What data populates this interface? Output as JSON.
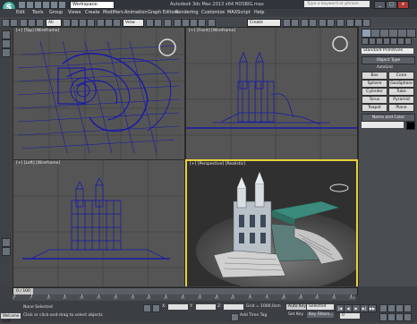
{
  "title_bar": {
    "logo_glyph": "S",
    "workspace": "Workspace: Default",
    "app_title": "Autodesk 3ds Max 2013 x64    HOSBIG.max",
    "search_placeholder": "Type a keyword or phrase"
  },
  "menu": [
    "Edit",
    "Tools",
    "Group",
    "Views",
    "Create",
    "Modifiers",
    "Animation",
    "Graph Editors",
    "Rendering",
    "Customize",
    "MAXScript",
    "Help"
  ],
  "toolbar": {
    "filter": "All",
    "ref_coord": "View",
    "selection_set": "Create Selection Se"
  },
  "viewports": [
    {
      "label": "[+] [Top] [Wireframe]"
    },
    {
      "label": "[+] [Front] [Wireframe]"
    },
    {
      "label": "[+] [Left] [Wireframe]"
    },
    {
      "label": "[+] [Perspective] [Realistic]"
    }
  ],
  "command_panel": {
    "category": "Standard Primitives",
    "object_type_title": "Object Type",
    "autogrid": "AutoGrid",
    "buttons": [
      "Box",
      "Cone",
      "Sphere",
      "GeoSphere",
      "Cylinder",
      "Tube",
      "Torus",
      "Pyramid",
      "Teapot",
      "Plane"
    ],
    "name_and_color": "Name and Color"
  },
  "timeline": {
    "frame_counter": "0 / 100",
    "ticks": [
      "0",
      "5",
      "10",
      "15",
      "20",
      "25",
      "30",
      "35",
      "40",
      "45",
      "50",
      "55",
      "60",
      "65",
      "70",
      "75",
      "80",
      "85",
      "90",
      "95",
      "100"
    ]
  },
  "status": {
    "welcome": "Welcome to M",
    "selection": "None Selected",
    "prompt": "Click or click-and-drag to select objects",
    "x_label": "X:",
    "y_label": "Y:",
    "z_label": "Z:",
    "grid": "Grid = 1000,0cm",
    "auto_key": "Auto Key",
    "selected": "Selected",
    "set_key": "Set Key",
    "key_filters": "Key Filters...",
    "add_time_tag": "Add Time Tag",
    "frame_value": "0"
  },
  "colors": {
    "active_viewport_border": "#e6d23a",
    "wireframe": "#1a1aa8",
    "name_swatch": "#000000"
  }
}
